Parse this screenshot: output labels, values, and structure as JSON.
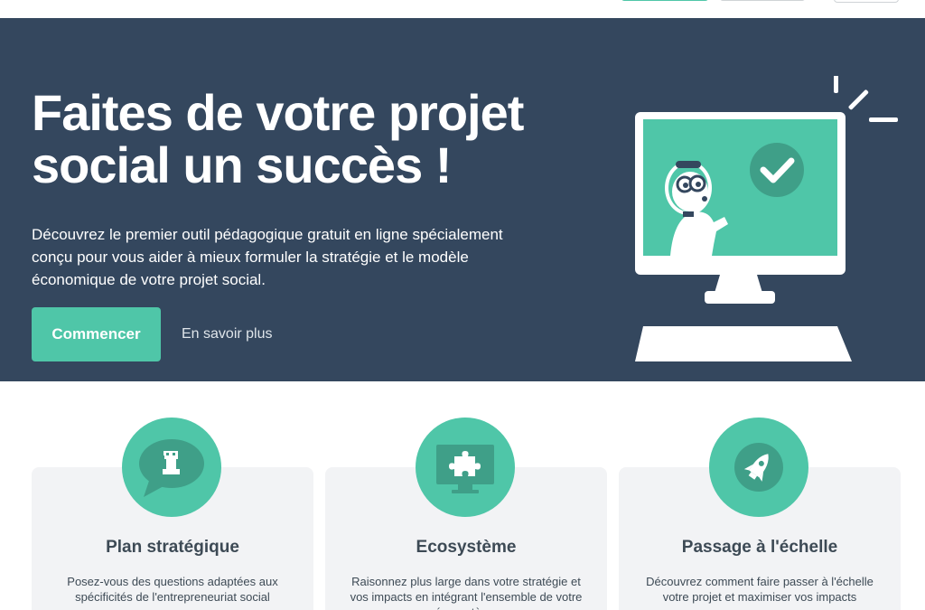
{
  "colors": {
    "hero_bg": "#34475e",
    "accent": "#4fc6a8",
    "accent_dark": "#3f9f88",
    "card_bg": "#f2f3f5",
    "text_dark": "#3d4a55"
  },
  "hero": {
    "title_line1": "Faites de votre projet",
    "title_line2": "social un succès !",
    "description": "Découvrez le premier outil pédagogique gratuit en ligne spécialement conçu pour vous aider à mieux formuler la stratégie et le modèle économique de votre projet social.",
    "cta_label": "Commencer",
    "more_label": "En savoir plus",
    "illustration_icon": "computer-with-character-icon"
  },
  "features": [
    {
      "title": "Plan stratégique",
      "text": "Posez-vous des questions adaptées aux spécificités de l'entrepreneuriat social",
      "icon": "chess-rook-icon"
    },
    {
      "title": "Ecosystème",
      "text": "Raisonnez plus large dans votre stratégie et vos impacts en intégrant l'ensemble de votre écosystème",
      "icon": "puzzle-piece-icon"
    },
    {
      "title": "Passage à l'échelle",
      "text": "Découvrez comment faire passer à l'échelle votre projet et maximiser vos impacts",
      "icon": "rocket-icon"
    }
  ]
}
